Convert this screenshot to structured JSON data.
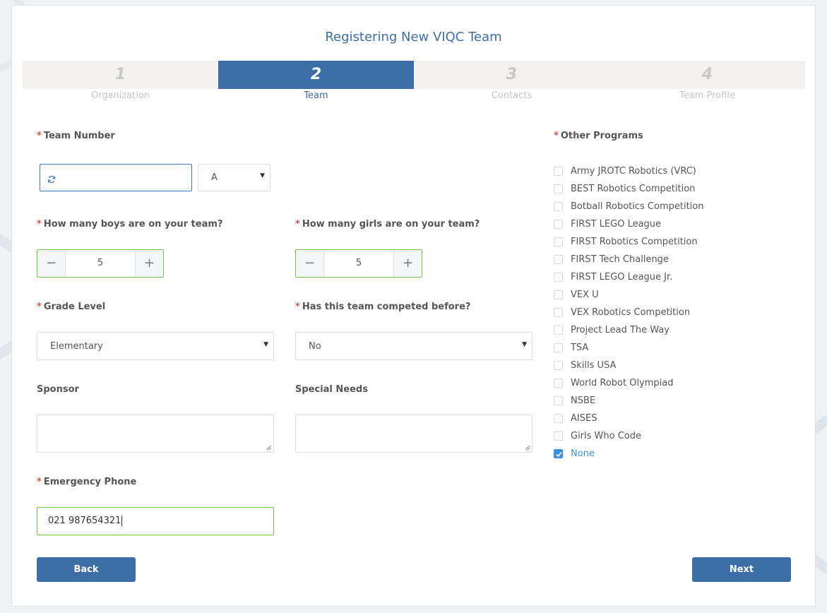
{
  "title": "Registering New VIQC Team",
  "steps": [
    {
      "num": "1",
      "label": "Organization"
    },
    {
      "num": "2",
      "label": "Team"
    },
    {
      "num": "3",
      "label": "Contacts"
    },
    {
      "num": "4",
      "label": "Team Profile"
    }
  ],
  "active_step": 2,
  "form": {
    "team_number": {
      "label": "Team Number",
      "value": "",
      "suffix": "A"
    },
    "boys": {
      "label": "How many boys are on your team?",
      "value": "5"
    },
    "girls": {
      "label": "How many girls are on your team?",
      "value": "5"
    },
    "grade_level": {
      "label": "Grade Level",
      "value": "Elementary"
    },
    "competed_before": {
      "label": "Has this team competed before?",
      "value": "No"
    },
    "sponsor": {
      "label": "Sponsor",
      "value": ""
    },
    "special_needs": {
      "label": "Special Needs",
      "value": ""
    },
    "emergency_phone": {
      "label": "Emergency Phone",
      "value": "021 987654321"
    },
    "required_mark": "*"
  },
  "other_programs": {
    "label": "Other Programs",
    "items": [
      {
        "label": "Army JROTC Robotics (VRC)",
        "checked": false
      },
      {
        "label": "BEST Robotics Competition",
        "checked": false
      },
      {
        "label": "Botball Robotics Competition",
        "checked": false
      },
      {
        "label": "FIRST LEGO League",
        "checked": false
      },
      {
        "label": "FIRST Robotics Competition",
        "checked": false
      },
      {
        "label": "FIRST Tech Challenge",
        "checked": false
      },
      {
        "label": "FIRST LEGO League Jr.",
        "checked": false
      },
      {
        "label": "VEX U",
        "checked": false
      },
      {
        "label": "VEX Robotics Competition",
        "checked": false
      },
      {
        "label": "Project Lead The Way",
        "checked": false
      },
      {
        "label": "TSA",
        "checked": false
      },
      {
        "label": "Skills USA",
        "checked": false
      },
      {
        "label": "World Robot Olympiad",
        "checked": false
      },
      {
        "label": "NSBE",
        "checked": false
      },
      {
        "label": "AISES",
        "checked": false
      },
      {
        "label": "Girls Who Code",
        "checked": false
      },
      {
        "label": "None",
        "checked": true
      }
    ]
  },
  "buttons": {
    "back": "Back",
    "next": "Next"
  },
  "icons": {
    "refresh": "refresh-icon",
    "minus": "minus-icon",
    "plus": "plus-icon",
    "caret": "caret-down-icon",
    "check": "check-icon"
  },
  "colors": {
    "primary": "#3d6ea8",
    "valid_border": "#6fc04a",
    "required": "#d9534f",
    "checked": "#3d8fe0"
  }
}
